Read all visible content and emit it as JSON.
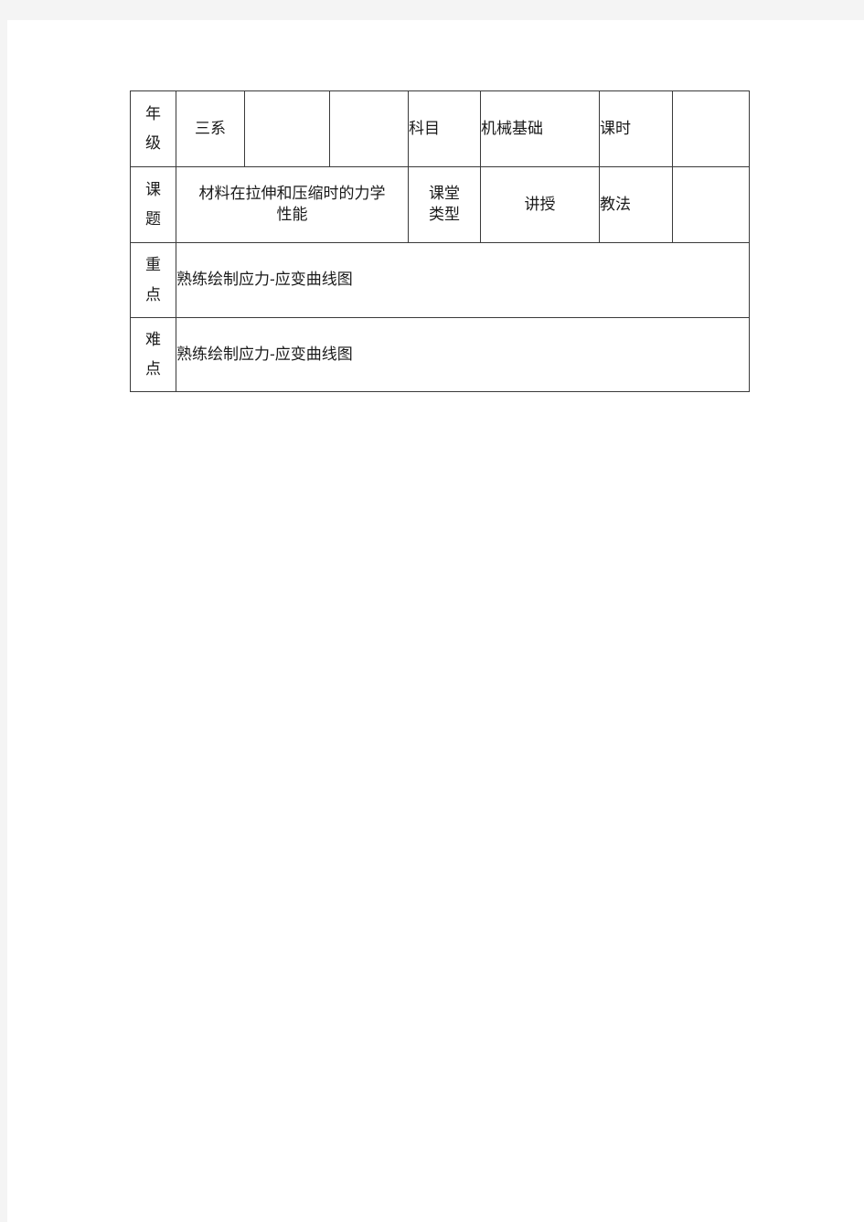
{
  "document": {
    "type": "lesson-plan-table",
    "page_background": "#ffffff",
    "margin_background": "#f4f4f4",
    "border_color": "#3a3a3a",
    "text_color": "#1a1a1a"
  },
  "table": {
    "rows": [
      {
        "name": "grade-row",
        "label": {
          "chars": [
            "年",
            "级"
          ],
          "text": "年级"
        },
        "cells": [
          {
            "name": "grade-value",
            "text": "三系",
            "align": "center"
          },
          {
            "name": "grade-extra-1",
            "text": "",
            "align": "center"
          },
          {
            "name": "grade-extra-2",
            "text": "",
            "align": "center"
          },
          {
            "name": "subject-label",
            "text": "科目",
            "align": "left"
          },
          {
            "name": "subject-value",
            "text": "机械基础",
            "align": "left"
          },
          {
            "name": "period-label",
            "text": "课时",
            "align": "left"
          },
          {
            "name": "period-value",
            "text": "",
            "align": "center"
          }
        ]
      },
      {
        "name": "topic-row",
        "label": {
          "chars": [
            "课",
            "题"
          ],
          "text": "课题"
        },
        "topic": {
          "name": "topic-value",
          "line1": "材料在拉伸和压缩时的力学",
          "line2": "性能",
          "full_text": "材料在拉伸和压缩时的力学性能"
        },
        "class_type": {
          "name": "class-type-label",
          "chars": [
            "课",
            "堂",
            "类",
            "型"
          ],
          "line1": "课堂",
          "line2": "类型",
          "text": "课堂类型"
        },
        "class_type_value": {
          "name": "class-type-value",
          "text": "讲授"
        },
        "method_label": {
          "name": "teaching-method-label",
          "text": "教法"
        },
        "method_value": {
          "name": "teaching-method-value",
          "text": ""
        }
      },
      {
        "name": "key-point-row",
        "label": {
          "chars": [
            "重",
            "点"
          ],
          "text": "重点"
        },
        "content": {
          "name": "key-point-value",
          "text": "熟练绘制应力-应变曲线图"
        }
      },
      {
        "name": "difficulty-row",
        "label": {
          "chars": [
            "难",
            "点"
          ],
          "text": "难点"
        },
        "content": {
          "name": "difficulty-value",
          "text": "熟练绘制应力-应变曲线图"
        }
      }
    ]
  }
}
